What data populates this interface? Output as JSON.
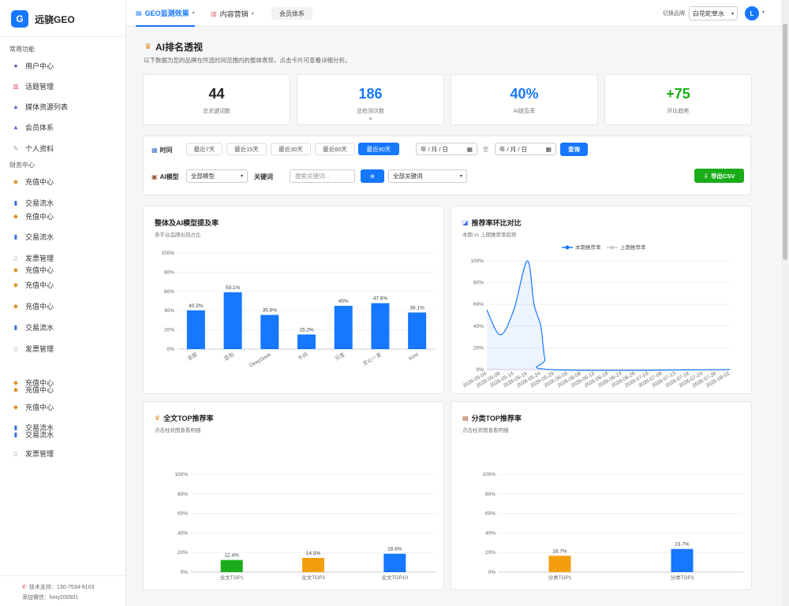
{
  "sidebar": {
    "brand_logo": "G",
    "brand_name": "远骁GEO",
    "section_common": "常用功能",
    "common_items": [
      {
        "label": "用户中心",
        "icon": "user-icon"
      },
      {
        "label": "话题管理",
        "icon": "document-icon"
      },
      {
        "label": "媒体资源列表",
        "icon": "building-icon"
      },
      {
        "label": "会员体系",
        "icon": "building-icon"
      },
      {
        "label": "个人资料",
        "icon": "pen-icon"
      }
    ],
    "section_finance": "财务中心",
    "finance_items": [
      {
        "label": "充值中心",
        "icon": "coin-icon"
      },
      {
        "label": "交易流水",
        "icon": "bar-chart-icon"
      },
      {
        "label": "充值中心",
        "icon": "coin-icon"
      },
      {
        "label": "交易流水",
        "icon": "bar-chart-icon"
      },
      {
        "label": "发票管理",
        "icon": "file-icon"
      },
      {
        "label": "充值中心",
        "icon": "coin-icon"
      },
      {
        "label": "充值中心",
        "icon": "coin-icon"
      },
      {
        "label": "充值中心",
        "icon": "coin-icon"
      },
      {
        "label": "交易流水",
        "icon": "bar-chart-icon"
      },
      {
        "label": "发票管理",
        "icon": "file-icon"
      },
      {
        "label": "充值中心",
        "icon": "coin-icon"
      },
      {
        "label": "充值中心",
        "icon": "coin-icon"
      },
      {
        "label": "充值中心",
        "icon": "coin-icon"
      },
      {
        "label": "交易流水",
        "icon": "bar-chart-icon"
      },
      {
        "label": "交易流水",
        "icon": "bar-chart-icon"
      },
      {
        "label": "发票管理",
        "icon": "file-icon"
      }
    ],
    "footer_phone": "技术支持：130-7534-9103",
    "footer_wechat": "添加微信：kmy200501"
  },
  "topbar": {
    "tabs": [
      {
        "label": "GEO监测效果",
        "icon": "chart-icon"
      },
      {
        "label": "内容营销",
        "icon": "document-icon"
      },
      {
        "label": "会员体系"
      }
    ],
    "brand_switch_label": "切换品牌",
    "brand_select_value": "白花蛇草水",
    "avatar_letter": "L"
  },
  "page": {
    "title": "AI排名透视",
    "subtitle": "以下数据为您的品牌在所选时间范围内的整体表现，点击卡片可查看详细分析。"
  },
  "kpis": [
    {
      "value": "44",
      "label": "总关键词数",
      "color": "#222222"
    },
    {
      "value": "186",
      "label": "总检测次数",
      "color": "#1677ff"
    },
    {
      "value": "40%",
      "label": "AI提及率",
      "color": "#1677ff"
    },
    {
      "value": "+75",
      "label": "环比趋势",
      "color": "#1aad19"
    }
  ],
  "filter": {
    "time_label": "时间",
    "ranges": [
      "最近7天",
      "最近15天",
      "最近30天",
      "最近60天",
      "最近90天"
    ],
    "active_range": "最近90天",
    "date_placeholder": "年 / 月 / 日",
    "date_sep": "至",
    "query_label": "查询",
    "model_label": "AI模型",
    "model_select": "全部模型",
    "keyword_label": "关键词",
    "keyword_placeholder": "搜索关键词...",
    "keyword_btn": "⊕",
    "keyword_select": "全部关键词",
    "export_label": "导出CSV"
  },
  "charts": {
    "overall": {
      "title": "整体及AI模型提及率",
      "subtitle": "各平台品牌出现占比"
    },
    "trend": {
      "title": "推荐率环比对比",
      "subtitle": "本期 vs 上期推荐率趋势"
    },
    "fulltext": {
      "title": "全文TOP推荐率",
      "subtitle": "点击柱状图查看明细"
    },
    "category": {
      "title": "分类TOP推荐率",
      "subtitle": "点击柱状图查看明细"
    }
  },
  "chart_data": [
    {
      "type": "bar",
      "title": "整体及AI模型提及率",
      "categories": [
        "全部",
        "豆包",
        "DeepSeek",
        "千问",
        "元宝",
        "文心一言",
        "Kimi"
      ],
      "values": [
        40.3,
        59.1,
        35.6,
        15.2,
        45,
        47.8,
        38.1
      ],
      "value_labels": [
        "40.3%",
        "59.1%",
        "35.6%",
        "15.2%",
        "45%",
        "47.8%",
        "38.1%"
      ],
      "ylim": [
        0,
        100
      ],
      "yticks": [
        "0%",
        "20%",
        "40%",
        "60%",
        "80%",
        "100%"
      ],
      "color": "#1677ff"
    },
    {
      "type": "line",
      "title": "推荐率环比对比",
      "series_names": [
        "本期推荐率",
        "上期推荐率"
      ],
      "x": [
        "2026-05-04",
        "2026-05-09",
        "2026-05-14",
        "2026-05-19",
        "2026-05-24",
        "2026-05-29",
        "2026-06-03",
        "2026-06-08",
        "2026-06-13",
        "2026-06-18",
        "2026-06-23",
        "2026-06-28",
        "2026-07-03",
        "2026-07-08",
        "2026-07-13",
        "2026-07-18",
        "2026-07-23",
        "2026-07-28",
        "2026-08-02"
      ],
      "current": [
        [
          0,
          55
        ],
        [
          1,
          32
        ],
        [
          2,
          55
        ],
        [
          3,
          100
        ],
        [
          3.5,
          60
        ],
        [
          4,
          40
        ],
        [
          4.3,
          10
        ],
        [
          4.8,
          0
        ],
        [
          18,
          0
        ]
      ],
      "ylim": [
        0,
        100
      ],
      "yticks": [
        "0%",
        "20%",
        "40%",
        "60%",
        "80%",
        "100%"
      ],
      "colors": [
        "#1677ff",
        "#cccccc"
      ]
    },
    {
      "type": "bar",
      "title": "全文TOP推荐率",
      "categories": [
        "全文TOP1",
        "全文TOP3",
        "全文TOP10"
      ],
      "values": [
        12.4,
        14.5,
        18.8
      ],
      "value_labels": [
        "12.4%",
        "14.5%",
        "18.8%"
      ],
      "colors": [
        "#1aad19",
        "#f59e0b",
        "#1677ff"
      ],
      "ylim": [
        0,
        100
      ],
      "yticks": [
        "0%",
        "20%",
        "40%",
        "60%",
        "80%",
        "100%"
      ]
    },
    {
      "type": "bar",
      "title": "分类TOP推荐率",
      "categories": [
        "分类TOP1",
        "分类TOP3"
      ],
      "values": [
        16.7,
        23.7
      ],
      "value_labels": [
        "16.7%",
        "23.7%"
      ],
      "colors": [
        "#f59e0b",
        "#1677ff"
      ],
      "ylim": [
        0,
        100
      ],
      "yticks": [
        "0%",
        "20%",
        "40%",
        "60%",
        "80%",
        "100%"
      ]
    }
  ]
}
